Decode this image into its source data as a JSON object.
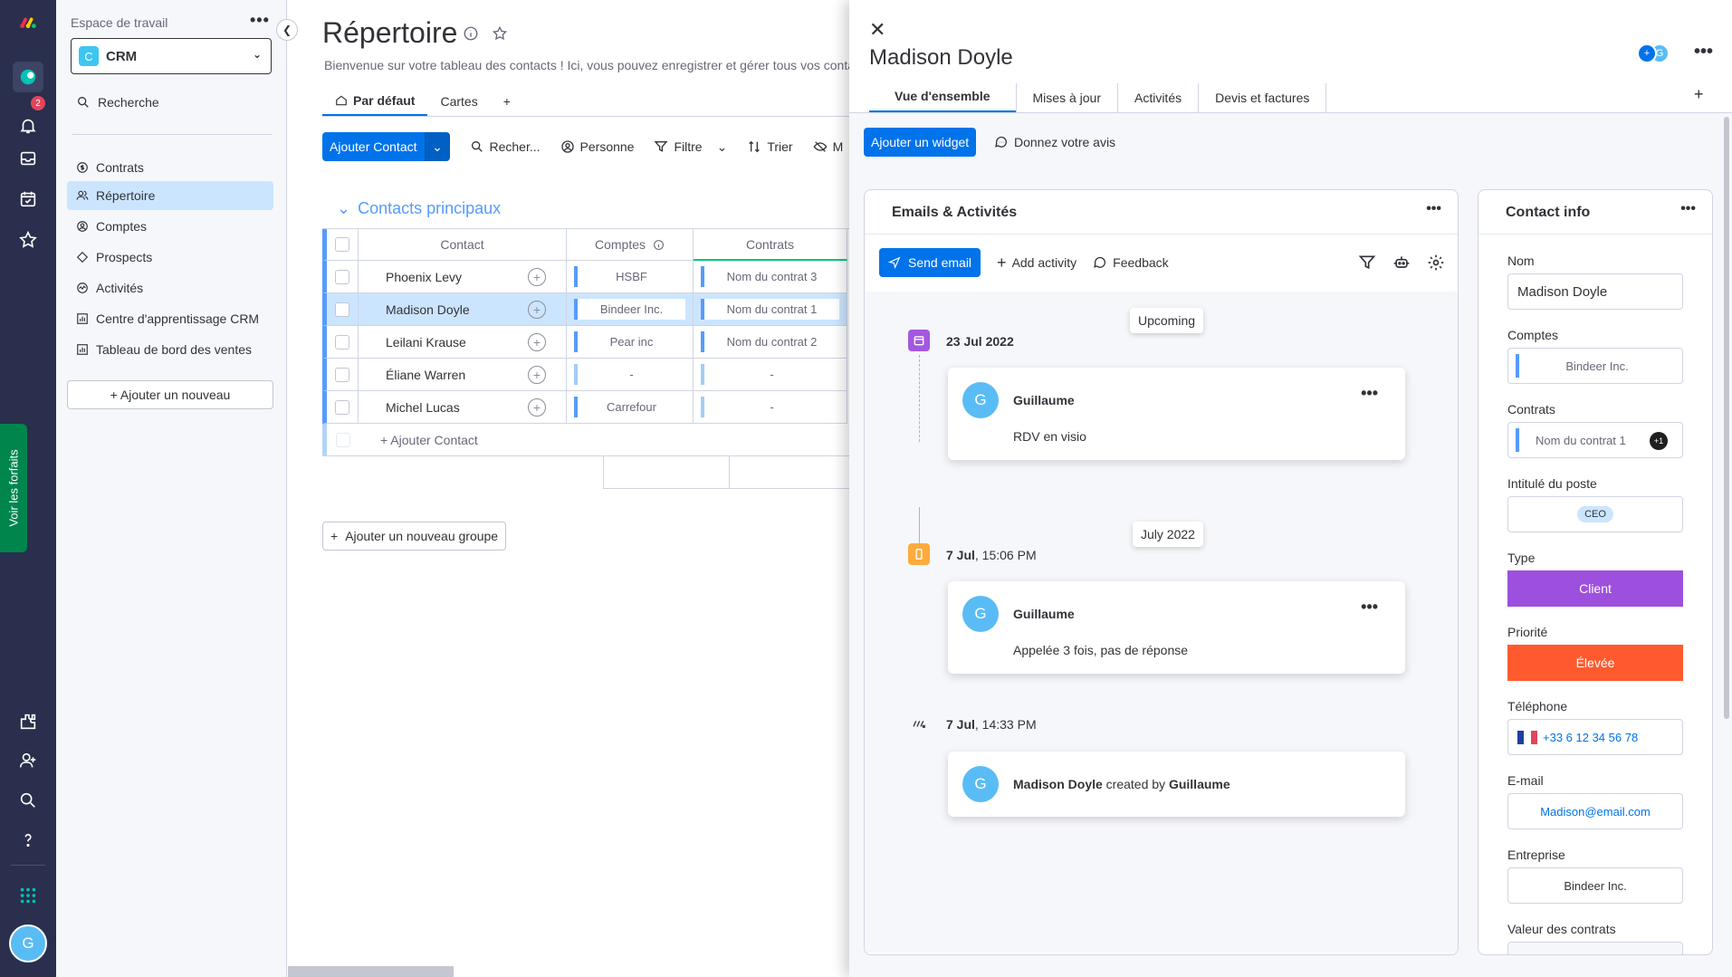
{
  "rail": {
    "notifications_count": "2",
    "plans_label": "Voir les forfaits",
    "user_initial": "G"
  },
  "workspace": {
    "label": "Espace de travail",
    "name": "CRM",
    "icon_letter": "C",
    "search_label": "Recherche",
    "items": [
      {
        "label": "Contrats",
        "icon": "dollar-icon"
      },
      {
        "label": "Répertoire",
        "icon": "contacts-icon"
      },
      {
        "label": "Comptes",
        "icon": "accounts-icon"
      },
      {
        "label": "Prospects",
        "icon": "diamond-icon"
      },
      {
        "label": "Activités",
        "icon": "activity-icon"
      },
      {
        "label": "Centre d'apprentissage CRM",
        "icon": "dashboard-icon"
      },
      {
        "label": "Tableau de bord des ventes",
        "icon": "dashboard-icon"
      }
    ],
    "add_new_label": "+ Ajouter un nouveau"
  },
  "board": {
    "title": "Répertoire",
    "description": "Bienvenue sur votre tableau des contacts ! Ici, vous pouvez enregistrer et gérer tous vos conta",
    "views": [
      "Par défaut",
      "Cartes"
    ],
    "toolbar": {
      "add_contact": "Ajouter Contact",
      "search": "Recher...",
      "person": "Personne",
      "filter": "Filtre",
      "sort": "Trier",
      "hide": "M"
    },
    "group_title": "Contacts principaux",
    "columns": {
      "contact": "Contact",
      "accounts": "Comptes",
      "contracts": "Contrats"
    },
    "rows": [
      {
        "name": "Phoenix Levy",
        "account": "HSBF",
        "contract": "Nom du contrat 3"
      },
      {
        "name": "Madison Doyle",
        "account": "Bindeer Inc.",
        "contract": "Nom du contrat 1"
      },
      {
        "name": "Leilani Krause",
        "account": "Pear inc",
        "contract": "Nom du contrat 2"
      },
      {
        "name": "Éliane Warren",
        "account": "-",
        "contract": "-"
      },
      {
        "name": "Michel Lucas",
        "account": "Carrefour",
        "contract": "-"
      }
    ],
    "add_row_label": "+ Ajouter Contact",
    "add_group_label": "Ajouter un nouveau groupe"
  },
  "panel": {
    "title": "Madison Doyle",
    "avatar_initial": "G",
    "tabs": [
      "Vue d'ensemble",
      "Mises à jour",
      "Activités",
      "Devis et factures"
    ],
    "add_widget": "Ajouter un widget",
    "feedback_top": "Donnez votre avis",
    "emails": {
      "title": "Emails & Activités",
      "send_email": "Send email",
      "add_activity": "Add activity",
      "feedback": "Feedback",
      "upcoming": "Upcoming",
      "month_label": "July 2022",
      "events": [
        {
          "date_bold": "23 Jul 2022",
          "date_rest": "",
          "user": "Guillaume",
          "text": "RDV en visio"
        },
        {
          "date_bold": "7 Jul",
          "date_rest": ", 15:06 PM",
          "user": "Guillaume",
          "text": "Appelée 3 fois, pas de réponse"
        },
        {
          "date_bold": "7 Jul",
          "date_rest": ", 14:33 PM",
          "created_name": "Madison Doyle",
          "created_by": " created by ",
          "created_user": "Guillaume"
        }
      ],
      "avatar_initial": "G"
    },
    "contact_info": {
      "title": "Contact info",
      "fields": {
        "name_label": "Nom",
        "name_value": "Madison Doyle",
        "accounts_label": "Comptes",
        "accounts_value": "Bindeer Inc.",
        "contracts_label": "Contrats",
        "contracts_value": "Nom du contrat 1",
        "contracts_more": "+1",
        "job_label": "Intitulé du poste",
        "job_value": "CEO",
        "type_label": "Type",
        "type_value": "Client",
        "type_color": "#9d50dd",
        "priority_label": "Priorité",
        "priority_value": "Élevée",
        "priority_color": "#ff5a2e",
        "phone_label": "Téléphone",
        "phone_value": "+33 6 12 34 56 78",
        "email_label": "E-mail",
        "email_value": "Madison@email.com",
        "company_label": "Entreprise",
        "company_value": "Bindeer Inc.",
        "contract_value_label": "Valeur des contrats"
      }
    }
  },
  "colors": {
    "accent": "#0073ea",
    "rail": "#292f4c",
    "group": "#579bfc"
  }
}
